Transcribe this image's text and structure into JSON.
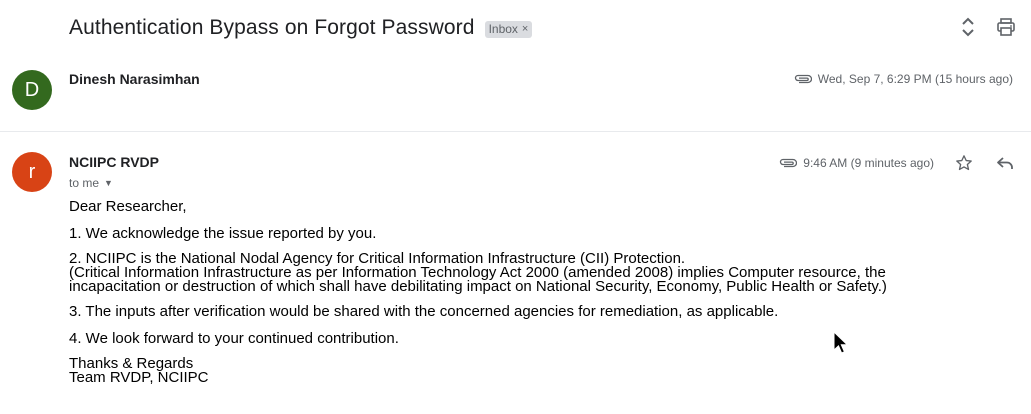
{
  "subject": {
    "title": "Authentication Bypass on Forgot Password",
    "label": "Inbox",
    "label_close": "×"
  },
  "toolbar": {
    "expand_icon": "unfold-icon",
    "print_icon": "print-icon"
  },
  "messages": [
    {
      "avatar_letter": "D",
      "avatar_color": "#33691e",
      "sender": "Dinesh Narasimhan",
      "has_attachment": true,
      "date": "Wed, Sep 7, 6:29 PM (15 hours ago)"
    },
    {
      "avatar_letter": "r",
      "avatar_color": "#d84315",
      "sender": "NCIIPC RVDP",
      "recipient": "to me",
      "has_attachment": true,
      "date": "9:46 AM (9 minutes ago)",
      "body": {
        "greeting": "Dear Researcher,",
        "point1": "1. We acknowledge the issue reported by you.",
        "point2_title": "2. NCIIPC is the National Nodal Agency for Critical Information Infrastructure (CII) Protection.",
        "point2_note_line1": "(Critical Information Infrastructure as per Information Technology Act 2000 (amended 2008) implies Computer resource, the",
        "point2_note_line2": "incapacitation or destruction of which shall have debilitating impact on National Security, Economy, Public Health or Safety.)",
        "point3": "3. The inputs after verification would be shared with the concerned agencies for remediation, as applicable.",
        "point4": "4. We look forward to your continued contribution.",
        "signoff": "Thanks & Regards",
        "signature": "Team RVDP, NCIIPC"
      }
    }
  ],
  "colors": {
    "text": "#202124",
    "secondary": "#5f6368",
    "chip_bg": "#dadce0",
    "divider": "#e8eaed"
  }
}
